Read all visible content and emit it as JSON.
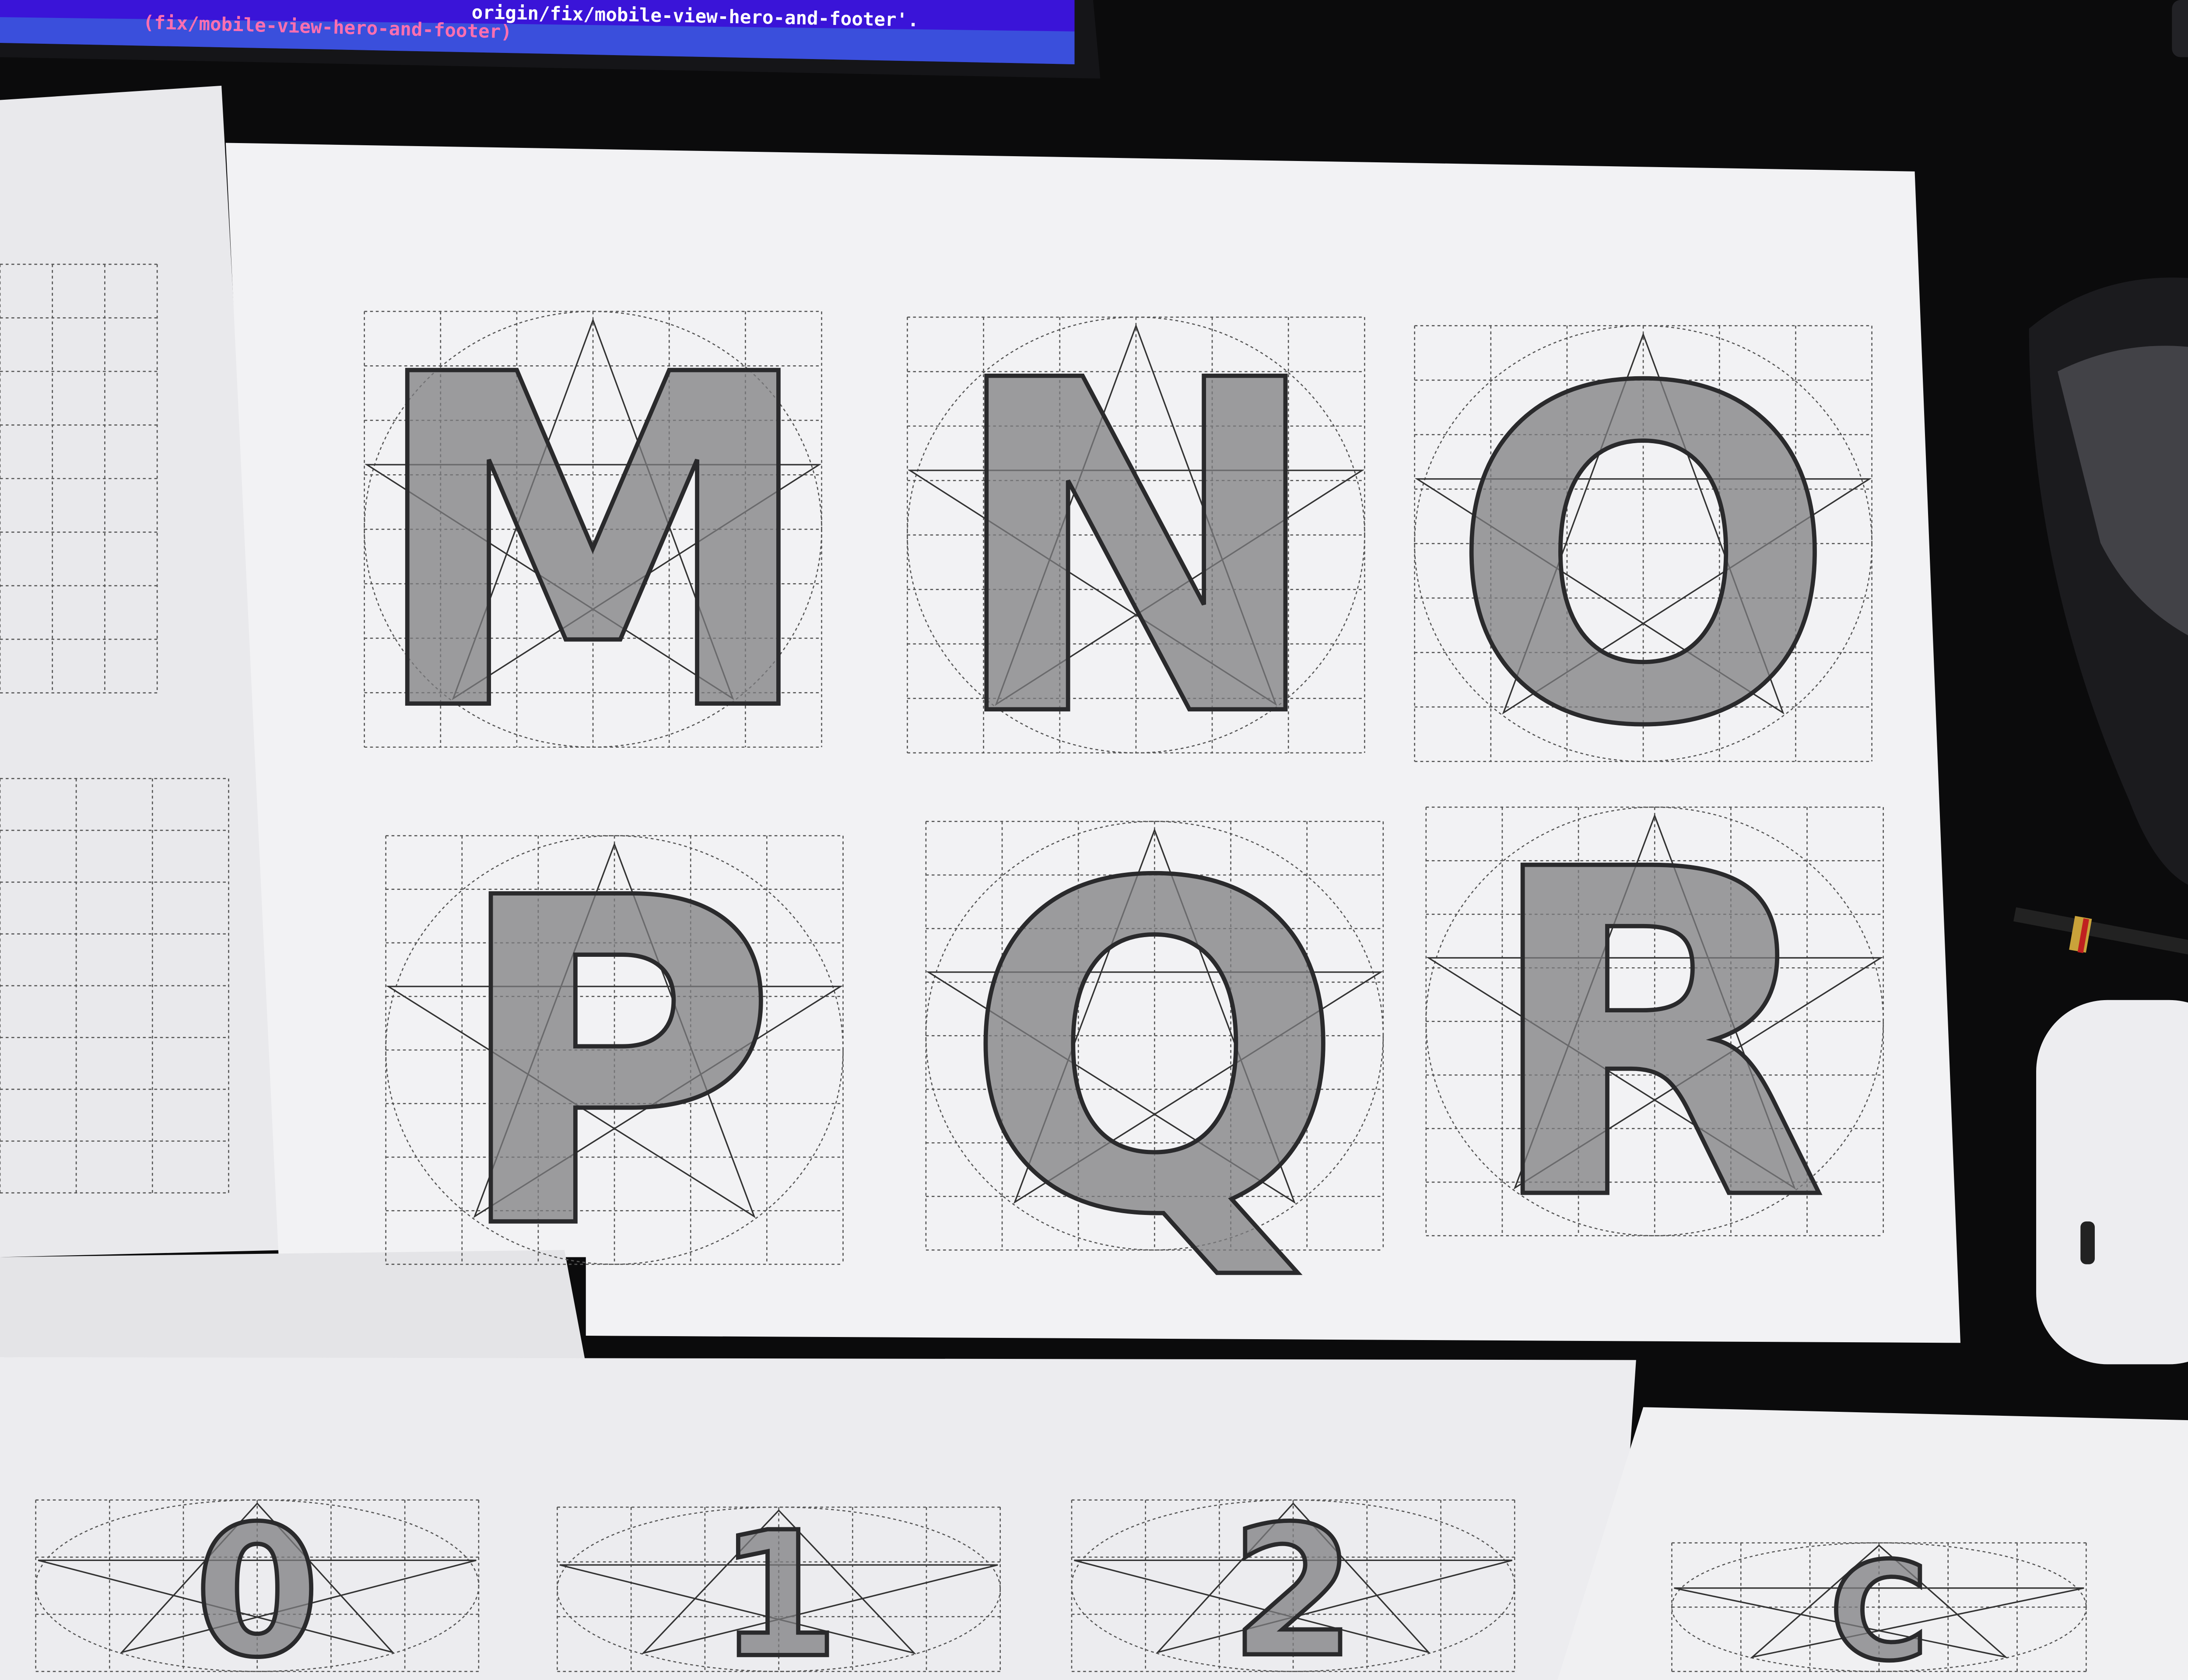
{
  "monitor": {
    "code_line_1": "origin/fix/mobile-view-hero-and-footer'.",
    "code_line_2": "(fix/mobile-view-hero-and-footer)"
  },
  "sheets": {
    "main_row_1": [
      "M",
      "N",
      "O"
    ],
    "main_row_2": [
      "P",
      "Q",
      "R"
    ],
    "bottom_row": [
      "0",
      "1",
      "2"
    ],
    "bottom_right": [
      "C"
    ]
  },
  "colors": {
    "desk": "#0b0b0c",
    "paper": "#f1f1f3",
    "pencil": "#6f6f72",
    "screen": "#3a14d8"
  }
}
